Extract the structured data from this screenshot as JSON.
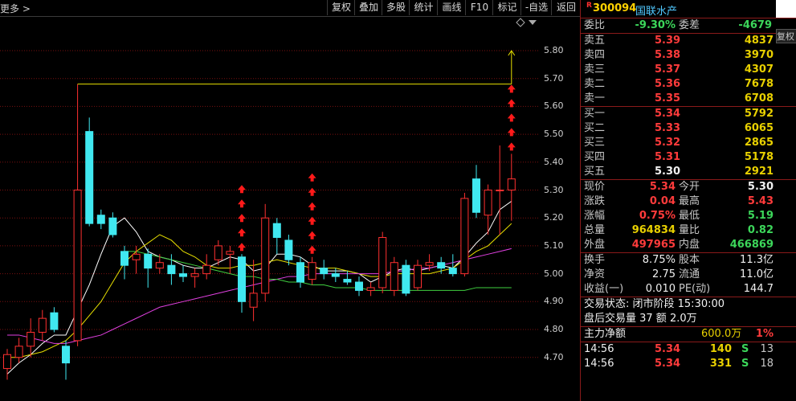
{
  "toolbar": {
    "more_label": "更多 >",
    "buttons": [
      "复权",
      "叠加",
      "多股",
      "统计",
      "画线",
      "F10",
      "标记",
      "-自选",
      "返回"
    ]
  },
  "price_axis": [
    "5.80",
    "5.70",
    "5.60",
    "5.50",
    "5.40",
    "5.30",
    "5.20",
    "5.10",
    "5.00",
    "4.90",
    "4.80",
    "4.70"
  ],
  "quote": {
    "badge": "R",
    "code": "300094",
    "name": "国联水产",
    "fuquan_label": "复权",
    "weibi_label": "委比",
    "weibi": "-9.30%",
    "weicha_label": "委差",
    "weicha": "-4679",
    "asks": [
      {
        "label": "卖五",
        "price": "5.39",
        "vol": "4837"
      },
      {
        "label": "卖四",
        "price": "5.38",
        "vol": "3970"
      },
      {
        "label": "卖三",
        "price": "5.37",
        "vol": "4307"
      },
      {
        "label": "卖二",
        "price": "5.36",
        "vol": "7678"
      },
      {
        "label": "卖一",
        "price": "5.35",
        "vol": "6708"
      }
    ],
    "bids": [
      {
        "label": "买一",
        "price": "5.34",
        "vol": "5792"
      },
      {
        "label": "买二",
        "price": "5.33",
        "vol": "6065"
      },
      {
        "label": "买三",
        "price": "5.32",
        "vol": "2865"
      },
      {
        "label": "买四",
        "price": "5.31",
        "vol": "5178"
      },
      {
        "label": "买五",
        "price": "5.30",
        "vol": "2921"
      }
    ],
    "stats": [
      {
        "l1": "现价",
        "v1": "5.34",
        "l2": "今开",
        "v2": "5.30"
      },
      {
        "l1": "涨跌",
        "v1": "0.04",
        "l2": "最高",
        "v2": "5.43"
      },
      {
        "l1": "涨幅",
        "v1": "0.75%",
        "l2": "最低",
        "v2": "5.19"
      },
      {
        "l1": "总量",
        "v1": "964834",
        "l2": "量比",
        "v2": "0.82"
      },
      {
        "l1": "外盘",
        "v1": "497965",
        "l2": "内盘",
        "v2": "466869"
      },
      {
        "l1": "换手",
        "v1": "8.75%",
        "l2": "股本",
        "v2": "11.3亿"
      },
      {
        "l1": "净资",
        "v1": "2.75",
        "l2": "流通",
        "v2": "11.0亿"
      },
      {
        "l1": "收益(一)",
        "v1": "0.010",
        "l2": "PE(动)",
        "v2": "144.7"
      }
    ],
    "trade_status": "交易状态: 闭市阶段 15:30:00",
    "after_hours": "盘后交易量 37 额 2.0万",
    "main_flow_label": "主力净额",
    "main_flow_value": "600.0万",
    "main_flow_pct": "1%",
    "ticks": [
      {
        "time": "14:56",
        "price": "5.34",
        "vol": "140",
        "side": "S",
        "count": "13"
      },
      {
        "time": "14:56",
        "price": "5.34",
        "vol": "331",
        "side": "S",
        "count": "18"
      }
    ]
  },
  "chart_data": {
    "type": "candlestick",
    "y_range": [
      4.65,
      5.87
    ],
    "candles": [
      {
        "o": 4.66,
        "c": 4.71,
        "h": 4.73,
        "l": 4.62
      },
      {
        "o": 4.7,
        "c": 4.74,
        "h": 4.77,
        "l": 4.68
      },
      {
        "o": 4.74,
        "c": 4.79,
        "h": 4.84,
        "l": 4.7
      },
      {
        "o": 4.79,
        "c": 4.84,
        "h": 4.87,
        "l": 4.76
      },
      {
        "o": 4.86,
        "c": 4.8,
        "h": 4.88,
        "l": 4.79
      },
      {
        "o": 4.74,
        "c": 4.68,
        "h": 4.76,
        "l": 4.62
      },
      {
        "o": 4.76,
        "c": 5.3,
        "h": 5.68,
        "l": 4.74
      },
      {
        "o": 5.51,
        "c": 5.18,
        "h": 5.56,
        "l": 5.17
      },
      {
        "o": 5.21,
        "c": 5.18,
        "h": 5.23,
        "l": 5.16
      },
      {
        "o": 5.2,
        "c": 5.14,
        "h": 5.22,
        "l": 5.13
      },
      {
        "o": 5.08,
        "c": 5.03,
        "h": 5.1,
        "l": 4.98
      },
      {
        "o": 5.05,
        "c": 5.07,
        "h": 5.1,
        "l": 5.0
      },
      {
        "o": 5.07,
        "c": 5.02,
        "h": 5.09,
        "l": 4.95
      },
      {
        "o": 5.02,
        "c": 5.04,
        "h": 5.07,
        "l": 5.0
      },
      {
        "o": 5.03,
        "c": 5.0,
        "h": 5.07,
        "l": 4.96
      },
      {
        "o": 5.0,
        "c": 4.99,
        "h": 5.03,
        "l": 4.97
      },
      {
        "o": 4.99,
        "c": 5.0,
        "h": 5.02,
        "l": 4.95
      },
      {
        "o": 5.0,
        "c": 5.03,
        "h": 5.07,
        "l": 4.98
      },
      {
        "o": 5.05,
        "c": 5.1,
        "h": 5.12,
        "l": 5.03
      },
      {
        "o": 5.07,
        "c": 5.08,
        "h": 5.1,
        "l": 5.0
      },
      {
        "o": 5.06,
        "c": 4.9,
        "h": 5.07,
        "l": 4.86
      },
      {
        "o": 4.88,
        "c": 4.93,
        "h": 5.05,
        "l": 4.83
      },
      {
        "o": 4.93,
        "c": 5.2,
        "h": 5.25,
        "l": 4.9
      },
      {
        "o": 5.18,
        "c": 5.13,
        "h": 5.2,
        "l": 5.07
      },
      {
        "o": 5.12,
        "c": 5.05,
        "h": 5.14,
        "l": 5.03
      },
      {
        "o": 5.04,
        "c": 4.97,
        "h": 5.06,
        "l": 4.95
      },
      {
        "o": 4.98,
        "c": 5.04,
        "h": 5.06,
        "l": 4.96
      },
      {
        "o": 5.02,
        "c": 5.0,
        "h": 5.05,
        "l": 4.98
      },
      {
        "o": 5.0,
        "c": 4.99,
        "h": 5.02,
        "l": 4.97
      },
      {
        "o": 4.98,
        "c": 4.97,
        "h": 5.01,
        "l": 4.96
      },
      {
        "o": 4.97,
        "c": 4.94,
        "h": 4.99,
        "l": 4.92
      },
      {
        "o": 4.94,
        "c": 4.95,
        "h": 4.97,
        "l": 4.92
      },
      {
        "o": 4.95,
        "c": 5.13,
        "h": 5.15,
        "l": 4.93
      },
      {
        "o": 4.94,
        "c": 5.04,
        "h": 5.06,
        "l": 4.92
      },
      {
        "o": 5.03,
        "c": 4.93,
        "h": 5.05,
        "l": 4.92
      },
      {
        "o": 4.95,
        "c": 5.03,
        "h": 5.05,
        "l": 4.94
      },
      {
        "o": 5.03,
        "c": 5.04,
        "h": 5.07,
        "l": 5.01
      },
      {
        "o": 5.04,
        "c": 5.02,
        "h": 5.06,
        "l": 5.0
      },
      {
        "o": 5.02,
        "c": 5.0,
        "h": 5.07,
        "l": 4.99
      },
      {
        "o": 5.0,
        "c": 5.27,
        "h": 5.29,
        "l": 4.99
      },
      {
        "o": 5.34,
        "c": 5.22,
        "h": 5.39,
        "l": 5.2
      },
      {
        "o": 5.21,
        "c": 5.3,
        "h": 5.32,
        "l": 5.14
      },
      {
        "o": 5.3,
        "c": 5.3,
        "h": 5.46,
        "l": 5.14
      },
      {
        "o": 5.3,
        "c": 5.34,
        "h": 5.43,
        "l": 5.19
      }
    ],
    "ma_lines": [
      {
        "color": "#ffffff",
        "values": [
          4.64,
          4.68,
          4.71,
          4.75,
          4.78,
          4.78,
          4.87,
          4.96,
          5.07,
          5.17,
          5.2,
          5.15,
          5.08,
          5.06,
          5.05,
          5.03,
          5.02,
          5.02,
          5.04,
          5.06,
          5.05,
          5.01,
          5.02,
          5.07,
          5.07,
          5.06,
          5.03,
          5.01,
          5.01,
          5.01,
          5.0,
          4.97,
          4.99,
          5.01,
          5.02,
          5.01,
          5.02,
          5.03,
          5.02,
          5.06,
          5.11,
          5.15,
          5.23,
          5.26
        ]
      },
      {
        "color": "#e8e000",
        "values": [
          4.7,
          4.7,
          4.71,
          4.72,
          4.74,
          4.76,
          4.8,
          4.85,
          4.9,
          4.97,
          5.04,
          5.08,
          5.11,
          5.14,
          5.12,
          5.08,
          5.06,
          5.03,
          5.02,
          5.02,
          5.03,
          5.03,
          5.04,
          5.05,
          5.04,
          5.03,
          5.02,
          5.02,
          5.02,
          5.01,
          5.0,
          4.99,
          4.99,
          5.0,
          5.0,
          5.0,
          5.0,
          5.01,
          5.02,
          5.05,
          5.08,
          5.1,
          5.14,
          5.18
        ]
      },
      {
        "color": "#e040e0",
        "values": [
          4.78,
          4.78,
          4.77,
          4.76,
          4.75,
          4.75,
          4.76,
          4.77,
          4.78,
          4.8,
          4.82,
          4.84,
          4.86,
          4.88,
          4.89,
          4.9,
          4.91,
          4.92,
          4.93,
          4.94,
          4.95,
          4.96,
          4.97,
          4.98,
          4.99,
          4.99,
          5.0,
          5.0,
          5.0,
          5.0,
          5.0,
          5.0,
          5.0,
          5.01,
          5.01,
          5.02,
          5.02,
          5.03,
          5.04,
          5.05,
          5.06,
          5.07,
          5.08,
          5.09
        ]
      },
      {
        "color": "#40d040",
        "values": [
          null,
          null,
          null,
          null,
          null,
          null,
          null,
          null,
          null,
          null,
          5.08,
          5.08,
          5.07,
          5.06,
          5.05,
          5.04,
          5.03,
          5.02,
          5.01,
          5.0,
          4.99,
          4.99,
          4.98,
          4.98,
          4.97,
          4.97,
          4.96,
          4.96,
          4.95,
          4.95,
          4.95,
          4.94,
          4.94,
          4.94,
          4.94,
          4.94,
          4.94,
          4.94,
          4.94,
          4.94,
          4.95,
          4.95,
          4.95,
          4.95
        ]
      }
    ],
    "arrow_columns": [
      {
        "index": 20,
        "count": 5
      },
      {
        "index": 26,
        "count": 6
      },
      {
        "index": 43,
        "count": 5
      }
    ],
    "high_line": {
      "value": 5.68,
      "from": 6,
      "to": 43
    },
    "up_arrow": {
      "index": 43,
      "from": 5.68,
      "to": 5.8
    }
  }
}
